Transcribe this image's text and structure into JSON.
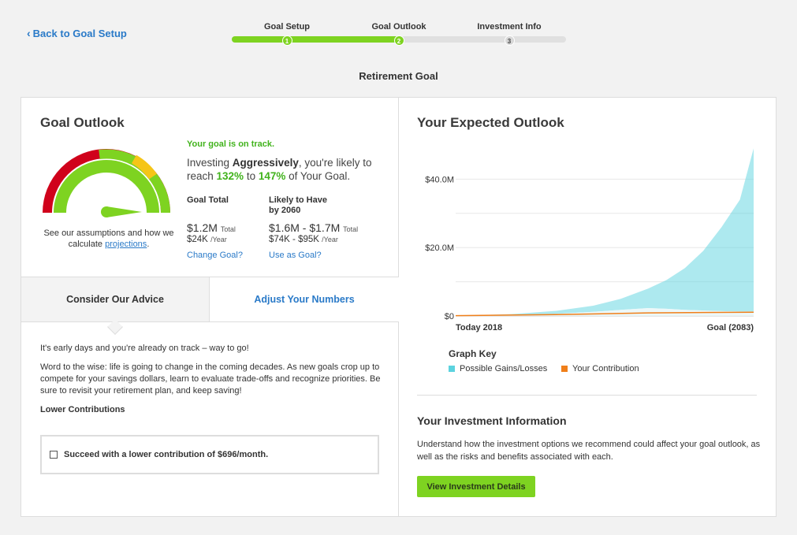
{
  "nav": {
    "back_label": "Back to Goal Setup"
  },
  "stepper": {
    "progress": 0.5,
    "steps": [
      {
        "label": "Goal Setup",
        "number": "1",
        "state": "complete"
      },
      {
        "label": "Goal Outlook",
        "number": "2",
        "state": "complete"
      },
      {
        "label": "Investment Info",
        "number": "3",
        "state": "upcoming"
      }
    ]
  },
  "page_title": "Retirement Goal",
  "outlook": {
    "title": "Goal Outlook",
    "status": "Your goal is on track.",
    "sentence": {
      "pre": "Investing ",
      "strategy": "Aggressively",
      "mid": ", you're likely to reach ",
      "low_pct": "132%",
      "to": " to ",
      "high_pct": "147%",
      "post": " of Your Goal."
    },
    "gauge_caption": "See our assumptions and how we calculate ",
    "gauge_link": "projections",
    "gauge_link_suffix": ".",
    "goal_total": {
      "header": "Goal Total",
      "amount": "$1.2M",
      "amount_suffix": "Total",
      "per_year": "$24K",
      "per_year_suffix": "/Year",
      "link": "Change Goal?"
    },
    "likely": {
      "header_line1": "Likely to Have",
      "header_line2": "by 2060",
      "amount": "$1.6M - $1.7M",
      "amount_suffix": "Total",
      "per_year": "$74K - $95K",
      "per_year_suffix": "/Year",
      "link": "Use as Goal?"
    },
    "colors": {
      "green": "#7ed321",
      "red": "#d0021b",
      "yellow": "#f5c518",
      "link": "#2a7ac8"
    }
  },
  "tabs": [
    {
      "label": "Consider Our Advice",
      "active": true
    },
    {
      "label": "Adjust Your Numbers",
      "active": false
    }
  ],
  "advice": {
    "p1": "It's early days and you're already on track – way to go!",
    "p2": "Word to the wise: life is going to change in the coming decades. As new goals crop up to compete for your savings dollars, learn to evaluate trade-offs and recognize priorities. Be sure to revisit your retirement plan, and keep saving!",
    "subheading": "Lower Contributions",
    "option_label": "Succeed with a lower contribution of $696/month."
  },
  "expected": {
    "title": "Your Expected Outlook",
    "graph_key_title": "Graph Key",
    "key_gains": "Possible Gains/Losses",
    "key_contrib": "Your Contribution",
    "color_gains": "#5cd3df",
    "color_contrib": "#f07f1a"
  },
  "chart_data": {
    "type": "area",
    "x_labels": [
      "Today 2018",
      "Goal (2083)"
    ],
    "x_range": [
      2018,
      2083
    ],
    "y_ticks": [
      "$0",
      "$20.0M",
      "$40.0M"
    ],
    "y_tick_values": [
      0,
      20,
      40
    ],
    "ylim": [
      0,
      50
    ],
    "y_unit": "M",
    "grid": true,
    "series": [
      {
        "name": "Possible Gains/Losses",
        "type": "band",
        "x": [
          2018,
          2030,
          2040,
          2048,
          2054,
          2060,
          2064,
          2068,
          2072,
          2076,
          2080,
          2083
        ],
        "upper": [
          0.1,
          0.5,
          1.5,
          3.0,
          5.0,
          8.0,
          10.5,
          14.0,
          19.0,
          26.0,
          34.0,
          49.0
        ],
        "lower": [
          0.1,
          0.2,
          0.6,
          1.2,
          1.8,
          2.3,
          2.1,
          1.8,
          1.6,
          1.4,
          1.3,
          1.3
        ]
      },
      {
        "name": "Your Contribution",
        "type": "line",
        "x": [
          2018,
          2040,
          2060,
          2083
        ],
        "values": [
          0.1,
          0.4,
          0.9,
          1.1
        ]
      }
    ]
  },
  "investment_info": {
    "title": "Your Investment Information",
    "text": "Understand how the investment options we recommend could affect your goal outlook, as well as the risks and benefits associated with each.",
    "button": "View Investment Details"
  }
}
